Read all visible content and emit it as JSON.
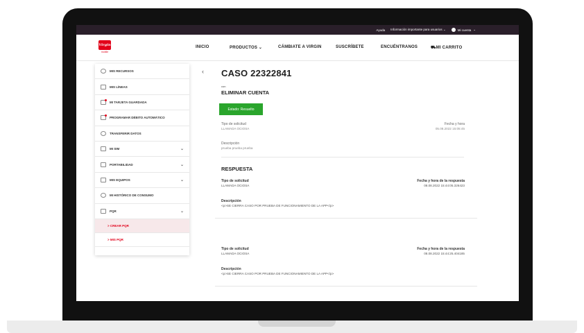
{
  "topbar": {
    "ayuda": "Ayuda",
    "info": "Información importante para usuarios",
    "mi_cuenta": "Mi cuenta"
  },
  "brand": {
    "logo_text": "Virgin",
    "logo_sub": "mobile",
    "color": "#e2001a"
  },
  "nav": {
    "inicio": "INICIO",
    "productos": "PRODUCTOS",
    "cambiate": "CÁMBIATE A VIRGIN",
    "suscribete": "SUSCRÍBETE",
    "encuentranos": "ENCUÉNTRANOS",
    "carrito": "MI CARRITO"
  },
  "sidebar": {
    "items": [
      {
        "label": "MIS RECURSOS"
      },
      {
        "label": "MIS LÍNEAS"
      },
      {
        "label": "MI TARJETA GUARDADA"
      },
      {
        "label": "PROGRAMAR DÉBITO AUTOMÁTICO"
      },
      {
        "label": "TRANSFERIR DATOS"
      },
      {
        "label": "MI SIM"
      },
      {
        "label": "PORTABILIDAD"
      },
      {
        "label": "MIS EQUIPOS"
      },
      {
        "label": "MI HISTÓRICO DE CONSUMO"
      },
      {
        "label": "PQR"
      }
    ],
    "sub": [
      {
        "label": "> CREAR PQR"
      },
      {
        "label": "> MIS PQR"
      }
    ]
  },
  "case": {
    "title": "CASO 22322841",
    "con": "con",
    "subject": "ELIMINAR CUENTA",
    "status": "Estado: Resuelto",
    "status_color": "#2aa52c",
    "tipo_label": "Tipo de solicitud",
    "tipo_value": "LLAMADA OCIOSA",
    "fecha_label": "Fecha y hora",
    "fecha_value": "05.08.2022 15:05:45",
    "desc_label": "Descripción",
    "desc_value": "prueba prueba prueba"
  },
  "respuesta": {
    "title": "RESPUESTA",
    "entries": [
      {
        "tipo_label": "Tipo de solicitud",
        "tipo_value": "LLAMADA OCIOSA",
        "fecha_label": "Fecha y hora de la respuesta",
        "fecha_value": "08.08.2022 15:44:05.326423",
        "desc_label": "Descripción",
        "desc_value": "<p>SE CIERRA CASO POR PRUEBA DE FUNCIONAMIENTO DE LA APP</p>"
      },
      {
        "tipo_label": "Tipo de solicitud",
        "tipo_value": "LLAMADA OCIOSA",
        "fecha_label": "Fecha y hora de la respuesta",
        "fecha_value": "08.08.2022 15:44:25.404185",
        "desc_label": "Descripción",
        "desc_value": "<p>SE CIERRA CASO POR PRUEBA DE FUNCIONAMIENTO DE LA APP</p>"
      }
    ]
  }
}
